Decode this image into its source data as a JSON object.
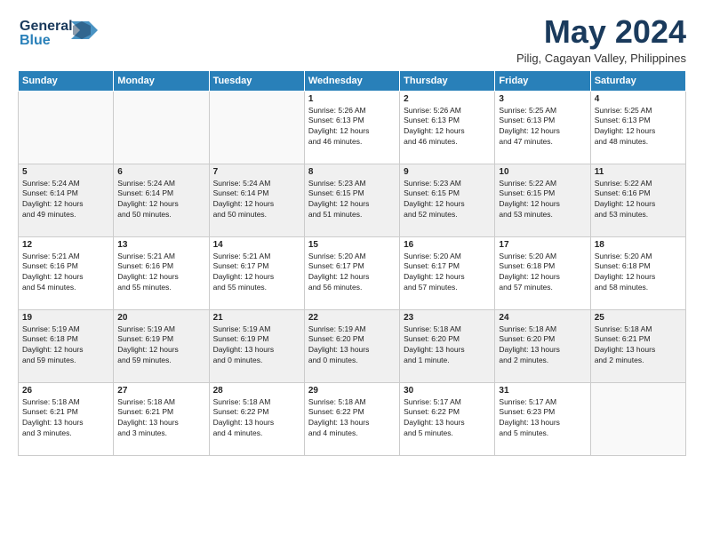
{
  "logo": {
    "line1": "General",
    "line2": "Blue"
  },
  "header": {
    "month": "May 2024",
    "subtitle": "Pilig, Cagayan Valley, Philippines"
  },
  "days_of_week": [
    "Sunday",
    "Monday",
    "Tuesday",
    "Wednesday",
    "Thursday",
    "Friday",
    "Saturday"
  ],
  "weeks": [
    [
      {
        "day": "",
        "info": ""
      },
      {
        "day": "",
        "info": ""
      },
      {
        "day": "",
        "info": ""
      },
      {
        "day": "1",
        "info": "Sunrise: 5:26 AM\nSunset: 6:13 PM\nDaylight: 12 hours\nand 46 minutes."
      },
      {
        "day": "2",
        "info": "Sunrise: 5:26 AM\nSunset: 6:13 PM\nDaylight: 12 hours\nand 46 minutes."
      },
      {
        "day": "3",
        "info": "Sunrise: 5:25 AM\nSunset: 6:13 PM\nDaylight: 12 hours\nand 47 minutes."
      },
      {
        "day": "4",
        "info": "Sunrise: 5:25 AM\nSunset: 6:13 PM\nDaylight: 12 hours\nand 48 minutes."
      }
    ],
    [
      {
        "day": "5",
        "info": "Sunrise: 5:24 AM\nSunset: 6:14 PM\nDaylight: 12 hours\nand 49 minutes."
      },
      {
        "day": "6",
        "info": "Sunrise: 5:24 AM\nSunset: 6:14 PM\nDaylight: 12 hours\nand 50 minutes."
      },
      {
        "day": "7",
        "info": "Sunrise: 5:24 AM\nSunset: 6:14 PM\nDaylight: 12 hours\nand 50 minutes."
      },
      {
        "day": "8",
        "info": "Sunrise: 5:23 AM\nSunset: 6:15 PM\nDaylight: 12 hours\nand 51 minutes."
      },
      {
        "day": "9",
        "info": "Sunrise: 5:23 AM\nSunset: 6:15 PM\nDaylight: 12 hours\nand 52 minutes."
      },
      {
        "day": "10",
        "info": "Sunrise: 5:22 AM\nSunset: 6:15 PM\nDaylight: 12 hours\nand 53 minutes."
      },
      {
        "day": "11",
        "info": "Sunrise: 5:22 AM\nSunset: 6:16 PM\nDaylight: 12 hours\nand 53 minutes."
      }
    ],
    [
      {
        "day": "12",
        "info": "Sunrise: 5:21 AM\nSunset: 6:16 PM\nDaylight: 12 hours\nand 54 minutes."
      },
      {
        "day": "13",
        "info": "Sunrise: 5:21 AM\nSunset: 6:16 PM\nDaylight: 12 hours\nand 55 minutes."
      },
      {
        "day": "14",
        "info": "Sunrise: 5:21 AM\nSunset: 6:17 PM\nDaylight: 12 hours\nand 55 minutes."
      },
      {
        "day": "15",
        "info": "Sunrise: 5:20 AM\nSunset: 6:17 PM\nDaylight: 12 hours\nand 56 minutes."
      },
      {
        "day": "16",
        "info": "Sunrise: 5:20 AM\nSunset: 6:17 PM\nDaylight: 12 hours\nand 57 minutes."
      },
      {
        "day": "17",
        "info": "Sunrise: 5:20 AM\nSunset: 6:18 PM\nDaylight: 12 hours\nand 57 minutes."
      },
      {
        "day": "18",
        "info": "Sunrise: 5:20 AM\nSunset: 6:18 PM\nDaylight: 12 hours\nand 58 minutes."
      }
    ],
    [
      {
        "day": "19",
        "info": "Sunrise: 5:19 AM\nSunset: 6:18 PM\nDaylight: 12 hours\nand 59 minutes."
      },
      {
        "day": "20",
        "info": "Sunrise: 5:19 AM\nSunset: 6:19 PM\nDaylight: 12 hours\nand 59 minutes."
      },
      {
        "day": "21",
        "info": "Sunrise: 5:19 AM\nSunset: 6:19 PM\nDaylight: 13 hours\nand 0 minutes."
      },
      {
        "day": "22",
        "info": "Sunrise: 5:19 AM\nSunset: 6:20 PM\nDaylight: 13 hours\nand 0 minutes."
      },
      {
        "day": "23",
        "info": "Sunrise: 5:18 AM\nSunset: 6:20 PM\nDaylight: 13 hours\nand 1 minute."
      },
      {
        "day": "24",
        "info": "Sunrise: 5:18 AM\nSunset: 6:20 PM\nDaylight: 13 hours\nand 2 minutes."
      },
      {
        "day": "25",
        "info": "Sunrise: 5:18 AM\nSunset: 6:21 PM\nDaylight: 13 hours\nand 2 minutes."
      }
    ],
    [
      {
        "day": "26",
        "info": "Sunrise: 5:18 AM\nSunset: 6:21 PM\nDaylight: 13 hours\nand 3 minutes."
      },
      {
        "day": "27",
        "info": "Sunrise: 5:18 AM\nSunset: 6:21 PM\nDaylight: 13 hours\nand 3 minutes."
      },
      {
        "day": "28",
        "info": "Sunrise: 5:18 AM\nSunset: 6:22 PM\nDaylight: 13 hours\nand 4 minutes."
      },
      {
        "day": "29",
        "info": "Sunrise: 5:18 AM\nSunset: 6:22 PM\nDaylight: 13 hours\nand 4 minutes."
      },
      {
        "day": "30",
        "info": "Sunrise: 5:17 AM\nSunset: 6:22 PM\nDaylight: 13 hours\nand 5 minutes."
      },
      {
        "day": "31",
        "info": "Sunrise: 5:17 AM\nSunset: 6:23 PM\nDaylight: 13 hours\nand 5 minutes."
      },
      {
        "day": "",
        "info": ""
      }
    ]
  ]
}
